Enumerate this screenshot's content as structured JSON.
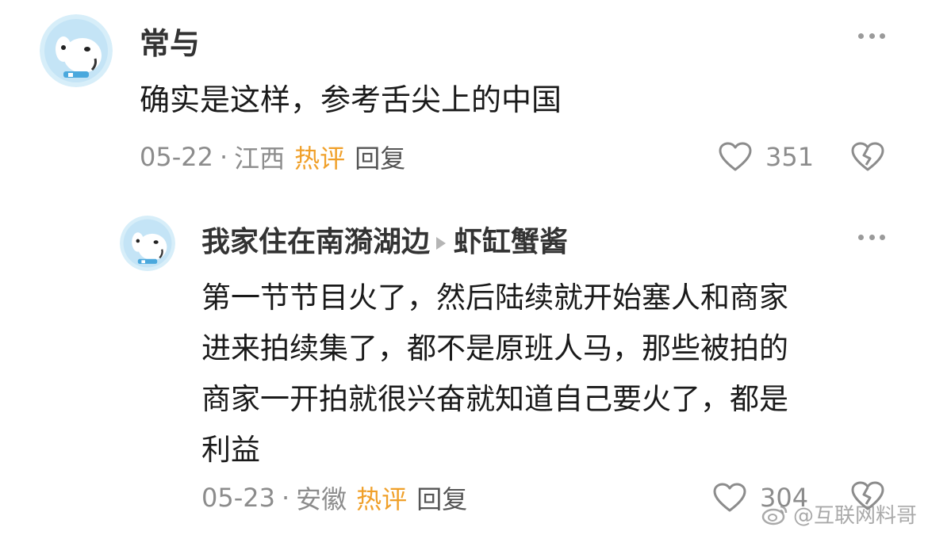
{
  "comments": [
    {
      "username": "常与",
      "text": "确实是这样，参考舌尖上的中国",
      "date": "05-22",
      "location": "江西",
      "hot_label": "热评",
      "reply_label": "回复",
      "likes": "351"
    },
    {
      "username": "我家住在南漪湖边",
      "reply_to": "虾缸蟹酱",
      "text_lines": [
        "第一节节目火了，然后陆续就开始塞人和商家",
        "进来拍续集了，都不是原班人马，那些被拍的",
        "商家一开拍就很兴奋就知道自己要火了，都是",
        "利益"
      ],
      "date": "05-23",
      "location": "安徽",
      "hot_label": "热评",
      "reply_label": "回复",
      "likes": "304"
    }
  ],
  "meta_separator": "·",
  "watermark": "@互联网料哥",
  "icons": {
    "more": "more-icon",
    "like": "heart-icon",
    "dislike": "broken-heart-icon",
    "watermark": "weibo-logo-icon"
  },
  "colors": {
    "hot": "#f0a02a",
    "meta": "#8c8c8c",
    "avatar_bg": "#cfe9f8"
  }
}
